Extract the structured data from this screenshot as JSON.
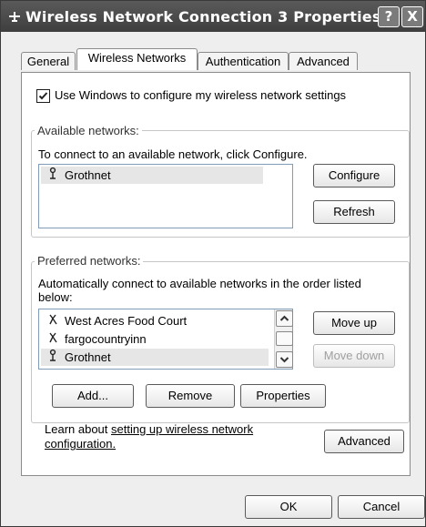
{
  "window": {
    "title": "Wireless Network Connection 3 Properties",
    "help_label": "?",
    "close_label": "X"
  },
  "tabs": [
    {
      "label": "General"
    },
    {
      "label": "Wireless Networks"
    },
    {
      "label": "Authentication"
    },
    {
      "label": "Advanced"
    }
  ],
  "use_windows_checkbox": {
    "label": "Use Windows to configure my wireless network settings",
    "checked": true
  },
  "available": {
    "group_title": "Available networks:",
    "instruction": "To connect to an available network, click Configure.",
    "networks": [
      {
        "name": "Grothnet",
        "icon": "antenna-icon",
        "selected": true
      }
    ],
    "configure_label": "Configure",
    "refresh_label": "Refresh"
  },
  "preferred": {
    "group_title": "Preferred networks:",
    "instruction_line1": "Automatically connect to available networks in the order listed",
    "instruction_line2": "below:",
    "networks": [
      {
        "name": "West Acres Food Court",
        "icon": "adhoc-icon"
      },
      {
        "name": "fargocountryinn",
        "icon": "adhoc-icon"
      },
      {
        "name": "Grothnet",
        "icon": "antenna-icon",
        "selected": true
      }
    ],
    "move_up_label": "Move up",
    "move_down_label": "Move down",
    "add_label": "Add...",
    "remove_label": "Remove",
    "properties_label": "Properties"
  },
  "learn": {
    "prefix": "Learn about ",
    "link_line1": "setting up wireless network",
    "link_line2": "configuration.",
    "advanced_label": "Advanced"
  },
  "footer": {
    "ok_label": "OK",
    "cancel_label": "Cancel"
  }
}
